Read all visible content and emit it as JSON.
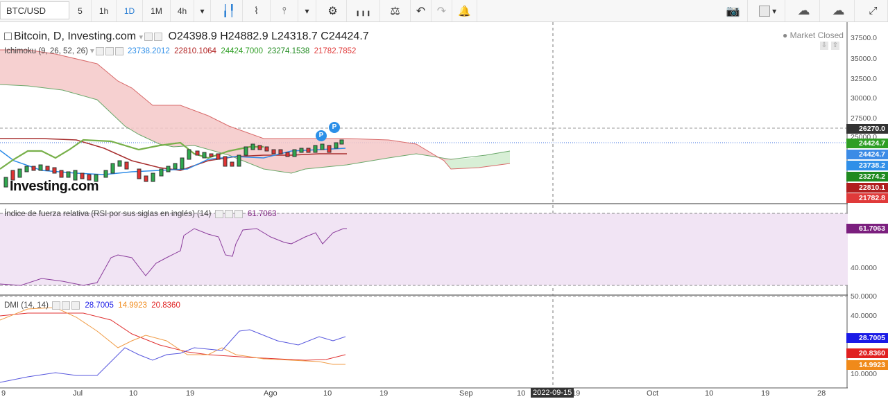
{
  "toolbar": {
    "symbol": "BTC/USD",
    "intervals": [
      "5",
      "1h",
      "1D",
      "1M",
      "4h"
    ],
    "active_interval": "1D"
  },
  "main": {
    "title": "Bitcoin, D, Investing.com",
    "ohlc": {
      "o": "O24398.9",
      "h": "H24882.9",
      "l": "L24318.7",
      "c": "C24424.7"
    },
    "market_status": "Market Closed",
    "ichimoku": {
      "label": "Ichimoku (9, 26, 52, 26)",
      "v1": "23738.2012",
      "v2": "22810.1064",
      "v3": "24424.7000",
      "v4": "23274.1538",
      "v5": "21782.7852"
    },
    "logo": "Investing.com",
    "price_axis": [
      "37500.0",
      "35000.0",
      "32500.0",
      "30000.0",
      "27500.0",
      "25000.0"
    ],
    "price_tags": [
      {
        "text": "26270.0",
        "color": "#333333"
      },
      {
        "text": "24424.7",
        "color": "#2e9e24"
      },
      {
        "text": "24424.7",
        "color": "#3b8be6"
      },
      {
        "text": "23738.2",
        "color": "#2f8fe8"
      },
      {
        "text": "23274.2",
        "color": "#1f8a1f"
      },
      {
        "text": "22810.1",
        "color": "#b01e1e"
      },
      {
        "text": "21782.8",
        "color": "#e03a3a"
      }
    ],
    "markers": [
      "P",
      "P"
    ]
  },
  "rsi": {
    "label": "Índice de fuerza relativa (RSI por sus siglas en inglés) (14)",
    "value": "61.7063",
    "axis": [
      "40.0000"
    ],
    "tag": "61.7063",
    "tag_color": "#7b1f7e"
  },
  "dmi": {
    "label": "DMI (14, 14)",
    "v1": "28.7005",
    "v2": "14.9923",
    "v3": "20.8360",
    "axis": [
      "50.0000",
      "40.0000",
      "10.0000"
    ],
    "tags": [
      {
        "text": "28.7005",
        "color": "#1a1ae6"
      },
      {
        "text": "20.8360",
        "color": "#e02020"
      },
      {
        "text": "14.9923",
        "color": "#f08a1a"
      }
    ]
  },
  "time_axis": {
    "labels": [
      "9",
      "Jul",
      "10",
      "19",
      "Ago",
      "10",
      "19",
      "Sep",
      "10",
      "19",
      "Oct",
      "10",
      "19",
      "28"
    ],
    "crosshair_date": "2022-09-15"
  },
  "chart_data": {
    "type": "line",
    "title": "Bitcoin, D, Investing.com",
    "xlabel": "",
    "ylabel": "",
    "series": [
      {
        "name": "Bitcoin",
        "values": [
          19300,
          20100,
          20600,
          19800,
          20200,
          21000,
          22500,
          23200,
          23900,
          23500,
          22900,
          23100,
          23800,
          23700,
          24100,
          24400,
          24600,
          24424.7
        ]
      },
      {
        "name": "RSI (14)",
        "values": [
          30,
          32,
          36,
          43,
          51,
          46,
          54,
          60,
          56,
          58,
          60,
          61.7063
        ]
      },
      {
        "name": "DMI",
        "values": [
          28.7005,
          14.9923,
          20.836
        ]
      }
    ]
  }
}
